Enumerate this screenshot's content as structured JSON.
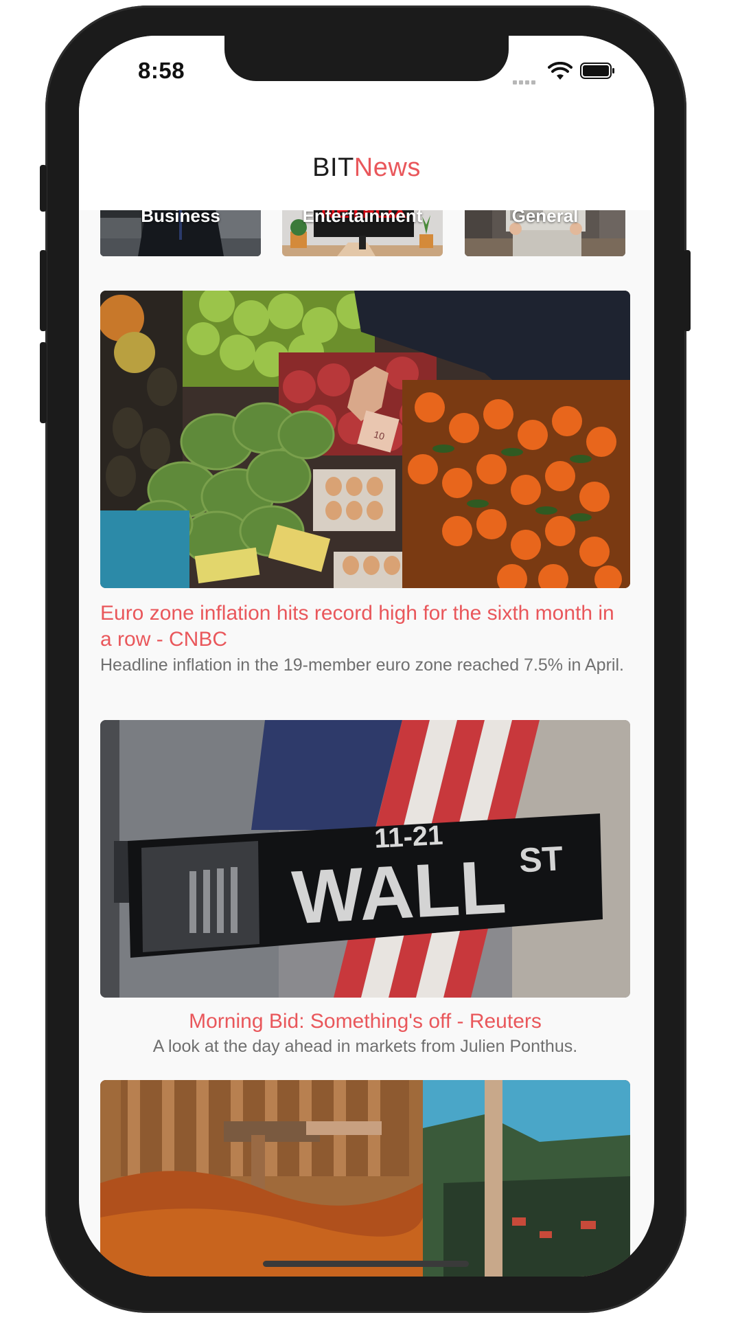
{
  "status_bar": {
    "time": "8:58"
  },
  "header": {
    "title_part1": "BIT",
    "title_part2": "News"
  },
  "categories": [
    {
      "label": "Business"
    },
    {
      "label": "Entertainment"
    },
    {
      "label": "General"
    }
  ],
  "articles": [
    {
      "title": "Euro zone inflation hits record high for the sixth month in a row - CNBC",
      "description": "Headline inflation in the 19-member euro zone reached 7.5% in April."
    },
    {
      "title": "Morning Bid: Something's off - Reuters",
      "description": "A look at the day ahead in markets from Julien Ponthus."
    }
  ],
  "images": {
    "netflix_text": "NETFLIX",
    "street_sign_number": "11-21",
    "street_sign_name": "WALL",
    "street_sign_suffix": "ST",
    "euro_note": "10"
  },
  "colors": {
    "accent": "#e9575b",
    "title_dark": "#1c1c1c",
    "description": "#6f6f6f"
  }
}
